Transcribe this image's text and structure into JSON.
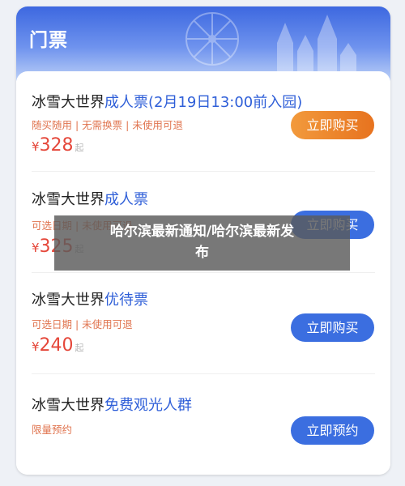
{
  "header": {
    "title": "门票"
  },
  "tickets": [
    {
      "name": "冰雪大世界",
      "type": "成人票(2月19日13:00前入园)",
      "tags": "随买随用 | 无需换票 | 未使用可退",
      "currency": "¥",
      "price": "328",
      "price_suffix": "起",
      "button": "立即购买"
    },
    {
      "name": "冰雪大世界",
      "type": "成人票",
      "tags": "可选日期 | 未使用可退",
      "currency": "¥",
      "price": "325",
      "price_suffix": "起",
      "button": "立即购买"
    },
    {
      "name": "冰雪大世界",
      "type": "优待票",
      "tags": "可选日期 | 未使用可退",
      "currency": "¥",
      "price": "240",
      "price_suffix": "起",
      "button": "立即购买"
    },
    {
      "name": "冰雪大世界",
      "type": "免费观光人群",
      "tags": "限量预约",
      "button": "立即预约"
    }
  ],
  "overlay": {
    "line1": "哈尔滨最新通知/哈尔滨最新发",
    "line2": "布"
  },
  "colors": {
    "accent_blue": "#3b6ee0",
    "price_red": "#e5473a",
    "tag_orange": "#e0744f",
    "button_orange": "#e7731f"
  }
}
